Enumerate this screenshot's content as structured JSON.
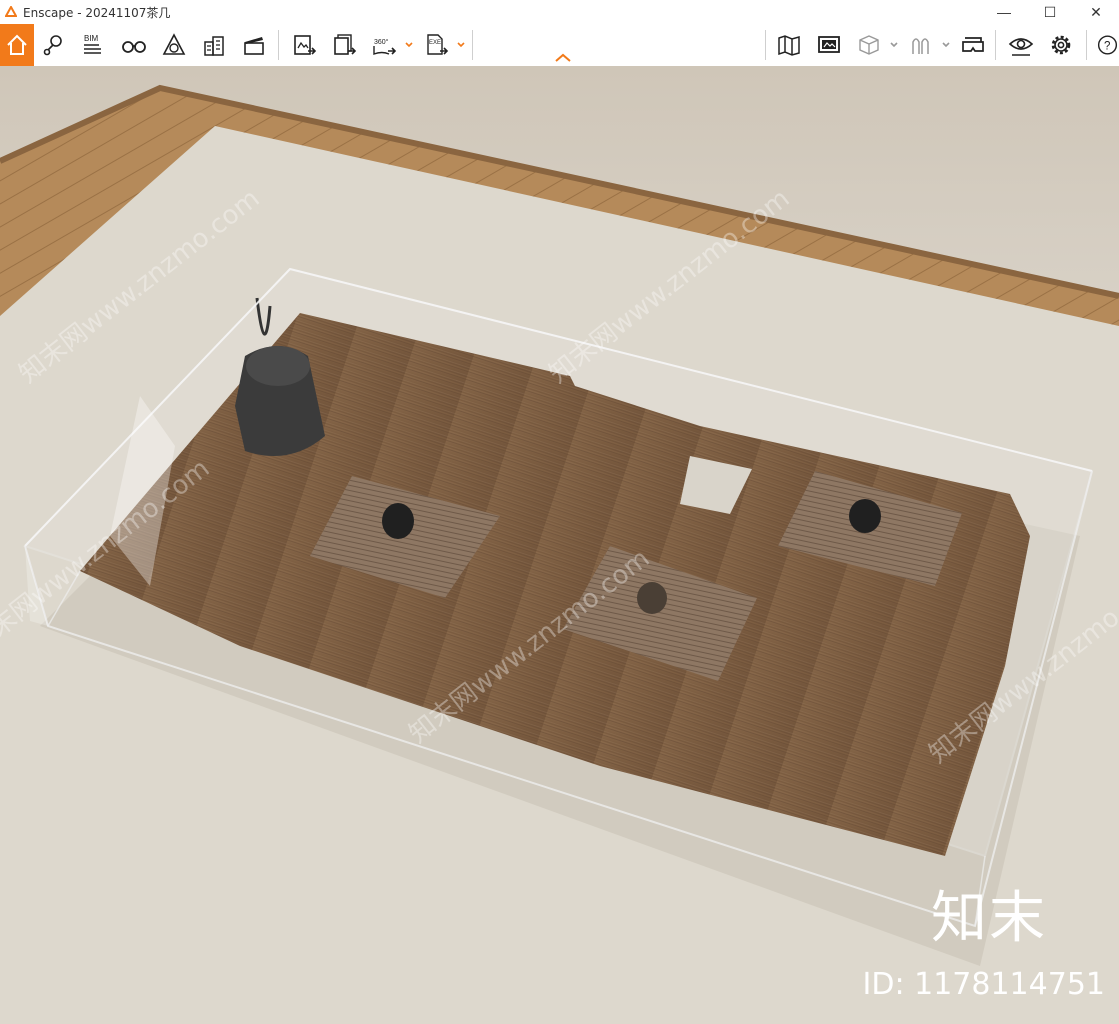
{
  "window": {
    "title": "Enscape - 20241107茶几",
    "minimize_glyph": "—",
    "maximize_glyph": "☐",
    "close_glyph": "✕"
  },
  "toolbar": {
    "accent_color": "#f27a1a",
    "left_tools": [
      {
        "name": "home",
        "icon": "home-icon"
      },
      {
        "name": "location",
        "icon": "map-pin-icon"
      },
      {
        "name": "bim",
        "icon": "bim-icon",
        "label": "BIM"
      },
      {
        "name": "binoculars",
        "icon": "binoculars-icon"
      },
      {
        "name": "atmosphere",
        "icon": "atmosphere-icon"
      },
      {
        "name": "asset-library",
        "icon": "buildings-icon"
      },
      {
        "name": "video-editor",
        "icon": "clapperboard-icon"
      },
      {
        "name": "render-screenshot",
        "icon": "screenshot-export-icon"
      },
      {
        "name": "batch-render",
        "icon": "batch-export-icon"
      },
      {
        "name": "panorama",
        "icon": "panorama-icon",
        "label": "360°"
      },
      {
        "name": "exe-export",
        "icon": "exe-export-icon",
        "label": "EXE"
      }
    ],
    "right_tools": [
      {
        "name": "map",
        "icon": "map-icon"
      },
      {
        "name": "views",
        "icon": "views-icon"
      },
      {
        "name": "section-box",
        "icon": "cube-icon"
      },
      {
        "name": "people",
        "icon": "people-icon"
      },
      {
        "name": "vr",
        "icon": "vr-headset-icon"
      },
      {
        "name": "visual-settings",
        "icon": "eye-icon"
      },
      {
        "name": "settings",
        "icon": "gear-icon"
      },
      {
        "name": "help",
        "icon": "help-icon"
      }
    ]
  },
  "watermark": {
    "site": "知末网www.znzmo.com",
    "logo": "知末",
    "id": "ID: 1178114751"
  }
}
